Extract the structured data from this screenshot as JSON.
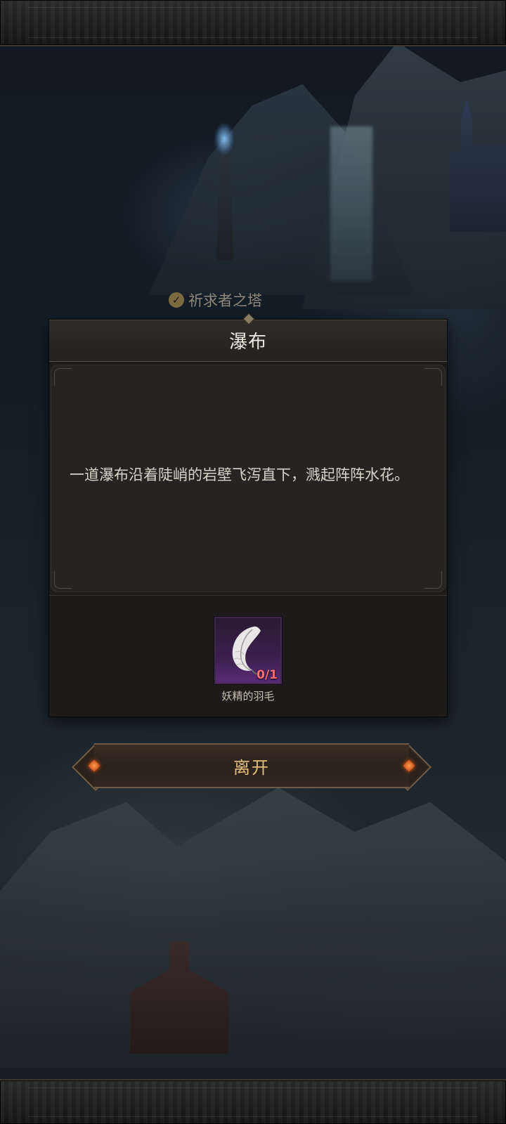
{
  "map": {
    "landmark_label": "祈求者之塔"
  },
  "dialog": {
    "title": "瀑布",
    "description": "一道瀑布沿着陡峭的岩壁飞泻直下，溅起阵阵水花。",
    "required_item": {
      "name": "妖精的羽毛",
      "icon": "feather-icon",
      "count": "0/1"
    }
  },
  "actions": {
    "leave_label": "离开"
  },
  "colors": {
    "item_count": "#ff6d6d",
    "leave_label": "#e3c07c",
    "item_slot": "#5a2a75"
  }
}
